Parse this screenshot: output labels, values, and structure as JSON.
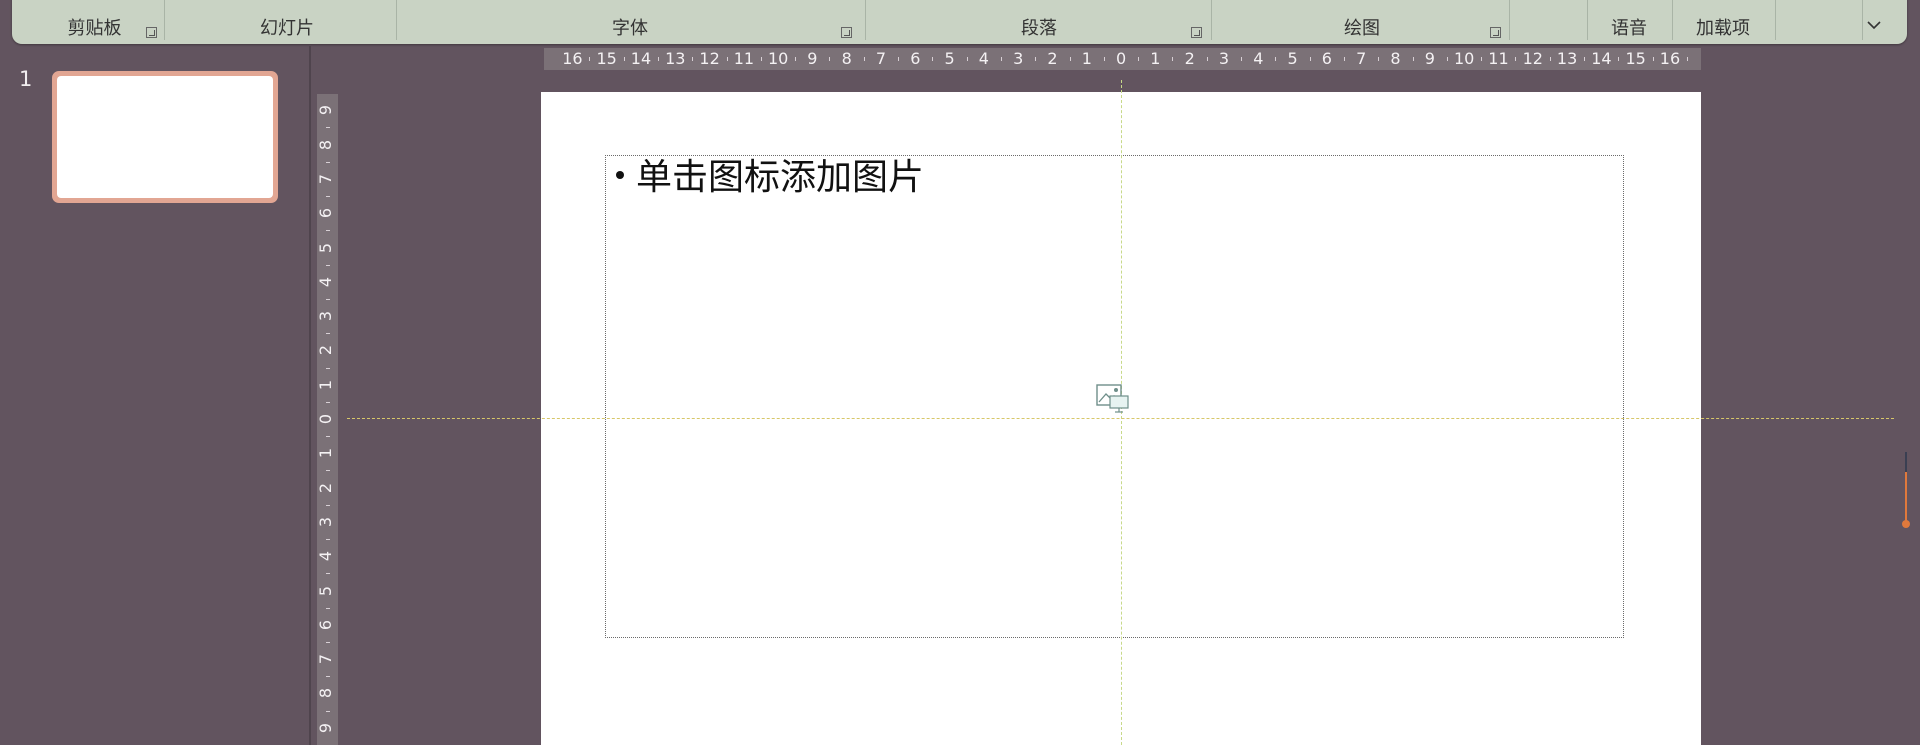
{
  "ribbon": {
    "groups": [
      {
        "label": "剪贴板",
        "has_launcher": true
      },
      {
        "label": "幻灯片",
        "has_launcher": false
      },
      {
        "label": "字体",
        "has_launcher": true
      },
      {
        "label": "段落",
        "has_launcher": true
      },
      {
        "label": "绘图",
        "has_launcher": true
      },
      {
        "label": "语音",
        "has_launcher": false
      },
      {
        "label": "加载项",
        "has_launcher": false
      }
    ],
    "collapse_icon": "chevron-down-icon"
  },
  "thumbnails": [
    {
      "number": "1",
      "selected": true
    }
  ],
  "slide": {
    "placeholder_text": "单击图标添加图片",
    "insert_icon": "insert-picture-icon"
  },
  "ruler_h": {
    "labels": [
      "16",
      "15",
      "14",
      "13",
      "12",
      "11",
      "10",
      "9",
      "8",
      "7",
      "6",
      "5",
      "4",
      "3",
      "2",
      "1",
      "0",
      "1",
      "2",
      "3",
      "4",
      "5",
      "6",
      "7",
      "8",
      "9",
      "10",
      "11",
      "12",
      "13",
      "14",
      "15",
      "16"
    ]
  },
  "ruler_v": {
    "labels": [
      "9",
      "8",
      "7",
      "6",
      "5",
      "4",
      "3",
      "2",
      "1",
      "0",
      "1",
      "2",
      "3",
      "4",
      "5",
      "6",
      "7",
      "8",
      "9"
    ]
  },
  "colors": {
    "background": "#62545f",
    "ribbon": "#c9d3c4",
    "thumbnail_selection": "#e2a693",
    "scroll_accent": "#e0793c"
  }
}
